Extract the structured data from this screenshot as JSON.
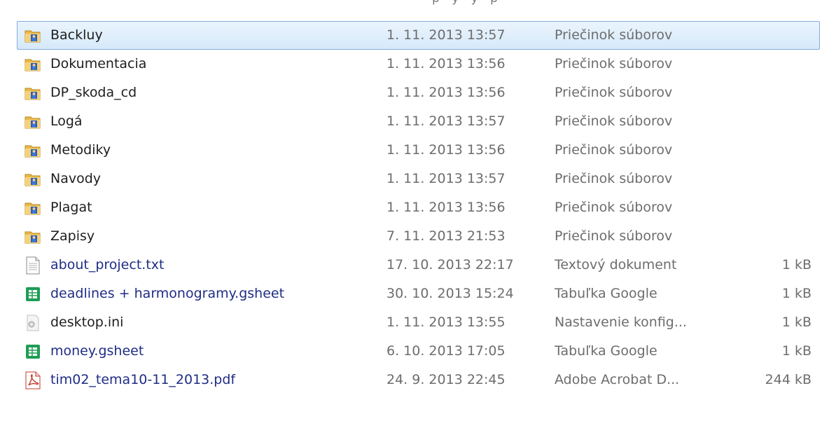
{
  "header_fragment": "p y   y p",
  "rows": [
    {
      "icon": "folder-icon",
      "name": "Backluy",
      "date": "1. 11. 2013 13:57",
      "type": "Priečinok súborov",
      "size": "",
      "kind": "folder",
      "selected": true
    },
    {
      "icon": "folder-icon",
      "name": "Dokumentacia",
      "date": "1. 11. 2013 13:56",
      "type": "Priečinok súborov",
      "size": "",
      "kind": "folder",
      "selected": false
    },
    {
      "icon": "folder-icon",
      "name": "DP_skoda_cd",
      "date": "1. 11. 2013 13:56",
      "type": "Priečinok súborov",
      "size": "",
      "kind": "folder",
      "selected": false
    },
    {
      "icon": "folder-icon",
      "name": "Logá",
      "date": "1. 11. 2013 13:57",
      "type": "Priečinok súborov",
      "size": "",
      "kind": "folder",
      "selected": false
    },
    {
      "icon": "folder-icon",
      "name": "Metodiky",
      "date": "1. 11. 2013 13:56",
      "type": "Priečinok súborov",
      "size": "",
      "kind": "folder",
      "selected": false
    },
    {
      "icon": "folder-icon",
      "name": "Navody",
      "date": "1. 11. 2013 13:57",
      "type": "Priečinok súborov",
      "size": "",
      "kind": "folder",
      "selected": false
    },
    {
      "icon": "folder-icon",
      "name": "Plagat",
      "date": "1. 11. 2013 13:56",
      "type": "Priečinok súborov",
      "size": "",
      "kind": "folder",
      "selected": false
    },
    {
      "icon": "folder-icon",
      "name": "Zapisy",
      "date": "7. 11. 2013 21:53",
      "type": "Priečinok súborov",
      "size": "",
      "kind": "folder",
      "selected": false
    },
    {
      "icon": "text-document-icon",
      "name": "about_project.txt",
      "date": "17. 10. 2013 22:17",
      "type": "Textový dokument",
      "size": "1 kB",
      "kind": "file",
      "selected": false
    },
    {
      "icon": "spreadsheet-icon",
      "name": "deadlines + harmonogramy.gsheet",
      "date": "30. 10. 2013 15:24",
      "type": "Tabuľka Google",
      "size": "1 kB",
      "kind": "file",
      "selected": false
    },
    {
      "icon": "settings-file-icon",
      "name": "desktop.ini",
      "date": "1. 11. 2013 13:55",
      "type": "Nastavenie konfig...",
      "size": "1 kB",
      "kind": "file-plain",
      "selected": false
    },
    {
      "icon": "spreadsheet-icon",
      "name": "money.gsheet",
      "date": "6. 10. 2013 17:05",
      "type": "Tabuľka Google",
      "size": "1 kB",
      "kind": "file",
      "selected": false
    },
    {
      "icon": "pdf-icon",
      "name": "tim02_tema10-11_2013.pdf",
      "date": "24. 9. 2013 22:45",
      "type": "Adobe Acrobat D...",
      "size": "244 kB",
      "kind": "file",
      "selected": false
    }
  ]
}
